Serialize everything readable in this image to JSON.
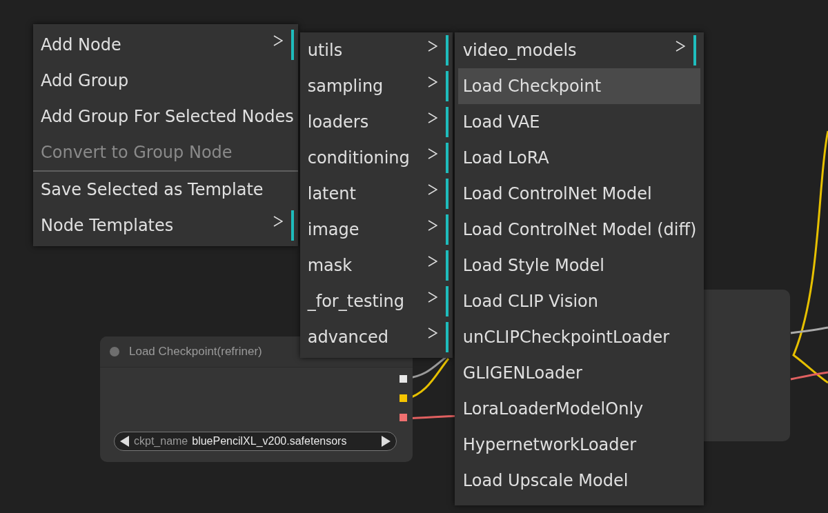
{
  "context_menu": {
    "items": [
      {
        "label": "Add Node",
        "kind": "submenu",
        "disabled": false,
        "separator_before": false
      },
      {
        "label": "Add Group",
        "kind": "action",
        "disabled": false,
        "separator_before": false
      },
      {
        "label": "Add Group For Selected Nodes",
        "kind": "action",
        "disabled": false,
        "separator_before": false
      },
      {
        "label": "Convert to Group Node",
        "kind": "action",
        "disabled": true,
        "separator_before": false
      },
      {
        "label": "Save Selected as Template",
        "kind": "action",
        "disabled": false,
        "separator_before": true
      },
      {
        "label": "Node Templates",
        "kind": "submenu",
        "disabled": false,
        "separator_before": false
      }
    ]
  },
  "category_menu": {
    "items": [
      {
        "label": "utils",
        "kind": "submenu"
      },
      {
        "label": "sampling",
        "kind": "submenu"
      },
      {
        "label": "loaders",
        "kind": "submenu"
      },
      {
        "label": "conditioning",
        "kind": "submenu"
      },
      {
        "label": "latent",
        "kind": "submenu"
      },
      {
        "label": "image",
        "kind": "submenu"
      },
      {
        "label": "mask",
        "kind": "submenu"
      },
      {
        "label": "_for_testing",
        "kind": "submenu"
      },
      {
        "label": "advanced",
        "kind": "submenu"
      }
    ]
  },
  "loaders_menu": {
    "items": [
      {
        "label": "video_models",
        "kind": "submenu",
        "selected": false
      },
      {
        "label": "Load Checkpoint",
        "kind": "action",
        "selected": true
      },
      {
        "label": "Load VAE",
        "kind": "action",
        "selected": false
      },
      {
        "label": "Load LoRA",
        "kind": "action",
        "selected": false
      },
      {
        "label": "Load ControlNet Model",
        "kind": "action",
        "selected": false
      },
      {
        "label": "Load ControlNet Model (diff)",
        "kind": "action",
        "selected": false
      },
      {
        "label": "Load Style Model",
        "kind": "action",
        "selected": false
      },
      {
        "label": "Load CLIP Vision",
        "kind": "action",
        "selected": false
      },
      {
        "label": "unCLIPCheckpointLoader",
        "kind": "action",
        "selected": false
      },
      {
        "label": "GLIGENLoader",
        "kind": "action",
        "selected": false
      },
      {
        "label": "LoraLoaderModelOnly",
        "kind": "action",
        "selected": false
      },
      {
        "label": "HypernetworkLoader",
        "kind": "action",
        "selected": false
      },
      {
        "label": "Load Upscale Model",
        "kind": "action",
        "selected": false
      }
    ]
  },
  "node": {
    "title": "Load Checkpoint(refriner)",
    "outputs": [
      {
        "color": "#e8e8e8"
      },
      {
        "color": "#f5c400"
      },
      {
        "color": "#f07070"
      }
    ],
    "widget": {
      "name": "ckpt_name",
      "value": "bluePencilXL_v200.safetensors"
    }
  }
}
